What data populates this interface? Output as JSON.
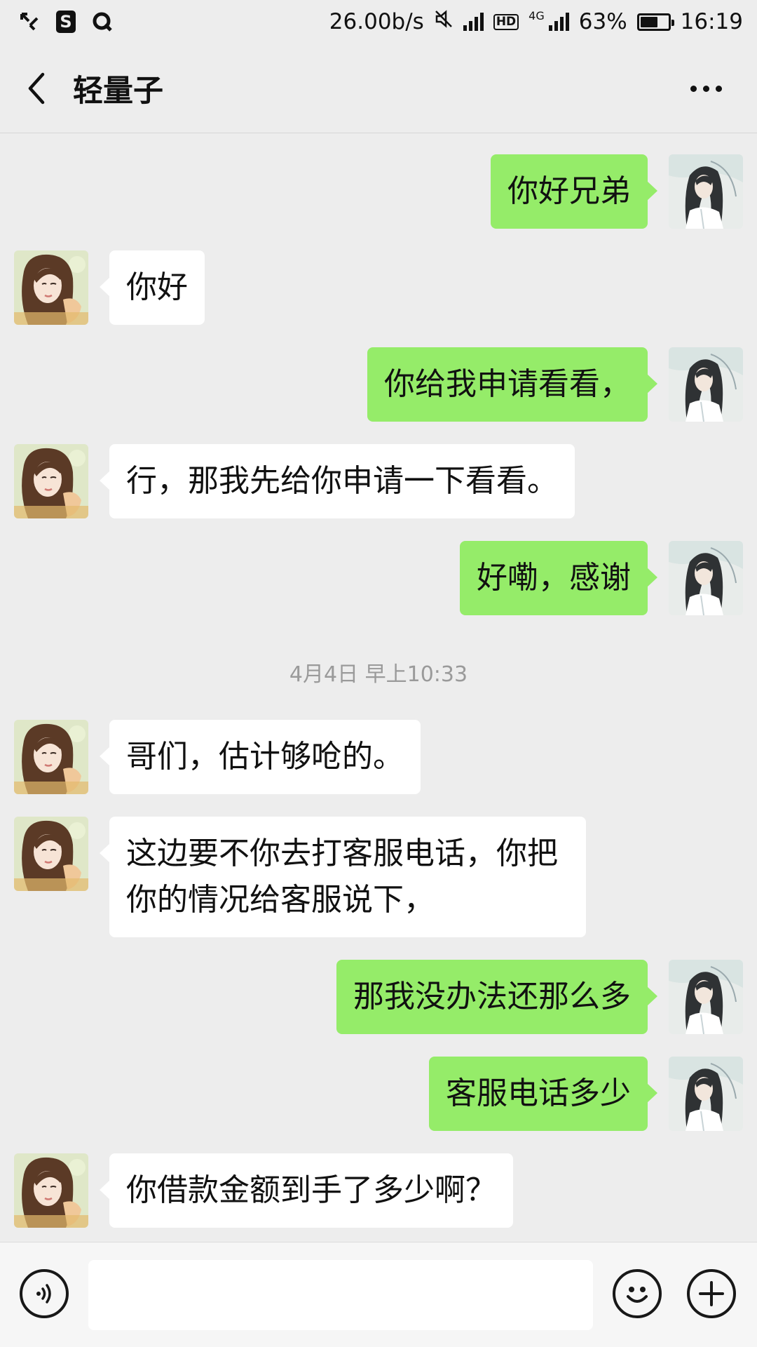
{
  "status_bar": {
    "speed": "26.00b/s",
    "network_type": "4G",
    "hd": "HD",
    "battery": "63%",
    "battery_level": 0.63,
    "time": "16:19",
    "icons": [
      "missed-call-icon",
      "app-s-icon",
      "app-q-icon",
      "mute-icon",
      "signal-icon",
      "signal-icon"
    ]
  },
  "header": {
    "title": "轻量子",
    "back_icon": "chevron-left-icon",
    "more_icon": "more-dots-icon"
  },
  "messages": [
    {
      "side": "sent",
      "text": "你好兄弟"
    },
    {
      "side": "recv",
      "text": "你好"
    },
    {
      "side": "sent",
      "text": "你给我申请看看，"
    },
    {
      "side": "recv",
      "text": "行，那我先给你申请一下看看。"
    },
    {
      "side": "sent",
      "text": "好嘞，感谢"
    },
    {
      "side": "recv",
      "text": "哥们，估计够呛的。"
    },
    {
      "side": "recv",
      "text": "这边要不你去打客服电话，你把你的情况给客服说下，"
    },
    {
      "side": "sent",
      "text": "那我没办法还那么多"
    },
    {
      "side": "sent",
      "text": "客服电话多少"
    },
    {
      "side": "recv",
      "text": "你借款金额到手了多少啊？"
    }
  ],
  "timestamp": "4月4日 早上10:33",
  "input_bar": {
    "voice_icon": "voice-icon",
    "emoji_icon": "emoji-icon",
    "plus_icon": "plus-icon",
    "input_value": ""
  },
  "colors": {
    "sent_bubble": "#95ec69",
    "recv_bubble": "#ffffff",
    "background": "#ededed"
  }
}
